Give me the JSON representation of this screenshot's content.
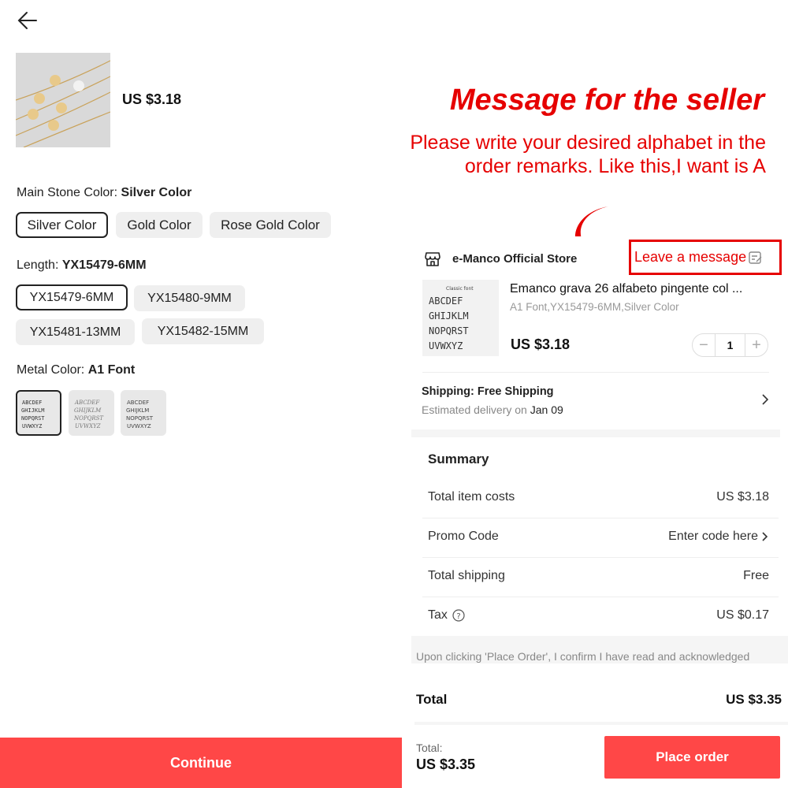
{
  "left": {
    "product_price": "US $3.18",
    "options": [
      {
        "label": "Main Stone Color: ",
        "selected": "Silver Color",
        "chips": [
          "Silver Color",
          "Gold Color",
          "Rose Gold Color"
        ]
      },
      {
        "label": "Length: ",
        "selected": "YX15479-6MM",
        "chips": [
          "YX15479-6MM",
          "YX15480-9MM",
          "YX15481-13MM",
          "YX15482-15MM"
        ]
      },
      {
        "label": "Metal Color: ",
        "selected": "A1 Font"
      }
    ],
    "continue_label": "Continue"
  },
  "right": {
    "promo": {
      "title": "Message for the seller",
      "subtitle": "Please write your desired alphabet in the order remarks. Like this,I want is A"
    },
    "store": {
      "name": "e-Manco Official Store",
      "leave_message": "Leave a message"
    },
    "product": {
      "title": "Emanco grava 26 alfabeto pingente col ...",
      "variant": "A1 Font,YX15479-6MM,Silver Color",
      "price": "US $3.18",
      "quantity": "1",
      "image_caption": "Classic font",
      "image_rows": [
        "ABCDEF",
        "GHIJKLM",
        "NOPQRST",
        "UVWXYZ"
      ]
    },
    "shipping": {
      "label": "Shipping: Free Shipping",
      "eta_prefix": "Estimated delivery on ",
      "eta_date": "Jan 09"
    },
    "summary": {
      "title": "Summary",
      "rows": [
        {
          "label": "Total item costs",
          "value": "US $3.18"
        },
        {
          "label": "Promo Code",
          "value": "Enter code here"
        },
        {
          "label": "Total shipping",
          "value": "Free"
        },
        {
          "label": "Tax",
          "value": "US $0.17"
        }
      ]
    },
    "disclaimer": "Upon clicking 'Place Order', I confirm I have read and acknowledged",
    "total": {
      "label": "Total",
      "value": "US $3.35"
    },
    "bottom": {
      "label": "Total:",
      "value": "US $3.35",
      "place_order": "Place order"
    }
  },
  "colors": {
    "accent": "#ff4747",
    "promo_red": "#e60000"
  }
}
